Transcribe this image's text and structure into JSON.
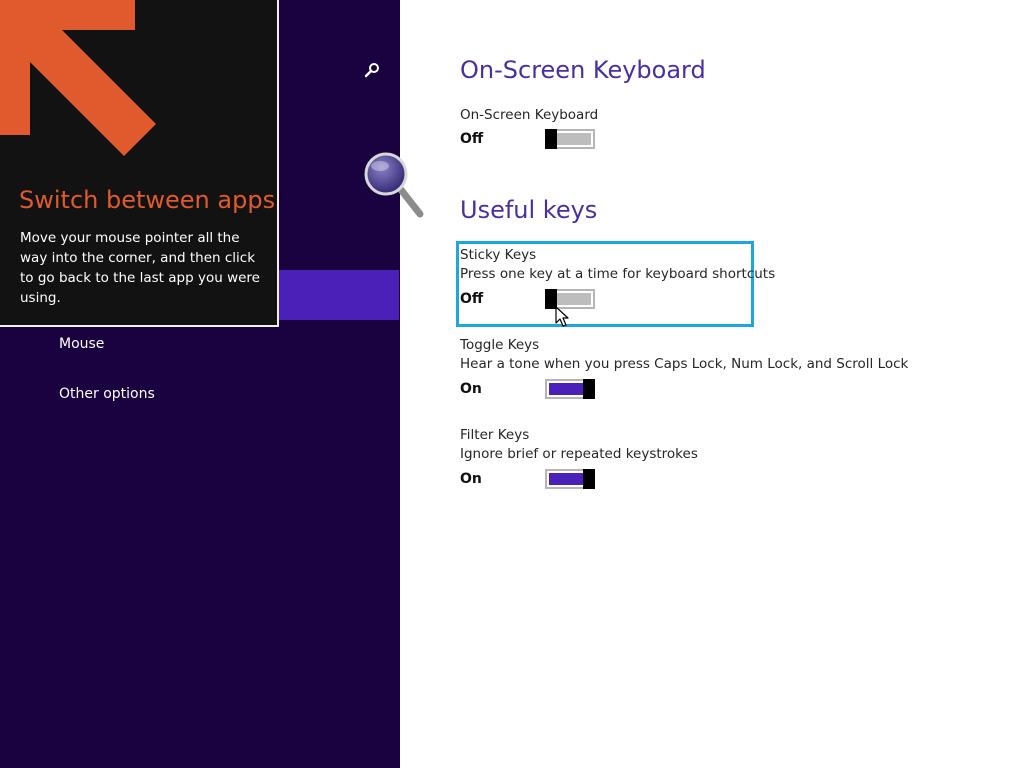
{
  "tip": {
    "title": "Switch between apps",
    "body": "Move your mouse pointer all the way into the corner, and then click to go back to the last app you were using.",
    "arrow_color": "#e05a2e"
  },
  "sidebar": {
    "search_icon": "search-icon",
    "items": [
      {
        "label": "Mouse"
      },
      {
        "label": "Other options"
      }
    ],
    "background": "#19023f",
    "selected_color": "#4a20b8"
  },
  "on_screen_keyboard": {
    "section_title": "On-Screen Keyboard",
    "label": "On-Screen Keyboard",
    "state": "Off",
    "toggle_on": false
  },
  "useful_keys": {
    "section_title": "Useful keys",
    "sticky_keys": {
      "label": "Sticky Keys",
      "description": "Press one key at a time for keyboard shortcuts",
      "state": "Off",
      "toggle_on": false
    },
    "toggle_keys": {
      "label": "Toggle Keys",
      "description": "Hear a tone when you press Caps Lock, Num Lock, and Scroll Lock",
      "state": "On",
      "toggle_on": true
    },
    "filter_keys": {
      "label": "Filter Keys",
      "description": "Ignore brief or repeated keystrokes",
      "state": "On",
      "toggle_on": true
    }
  },
  "colors": {
    "accent": "#4a20b8",
    "focus": "#1ea7dc",
    "title": "#4b2fa0"
  }
}
